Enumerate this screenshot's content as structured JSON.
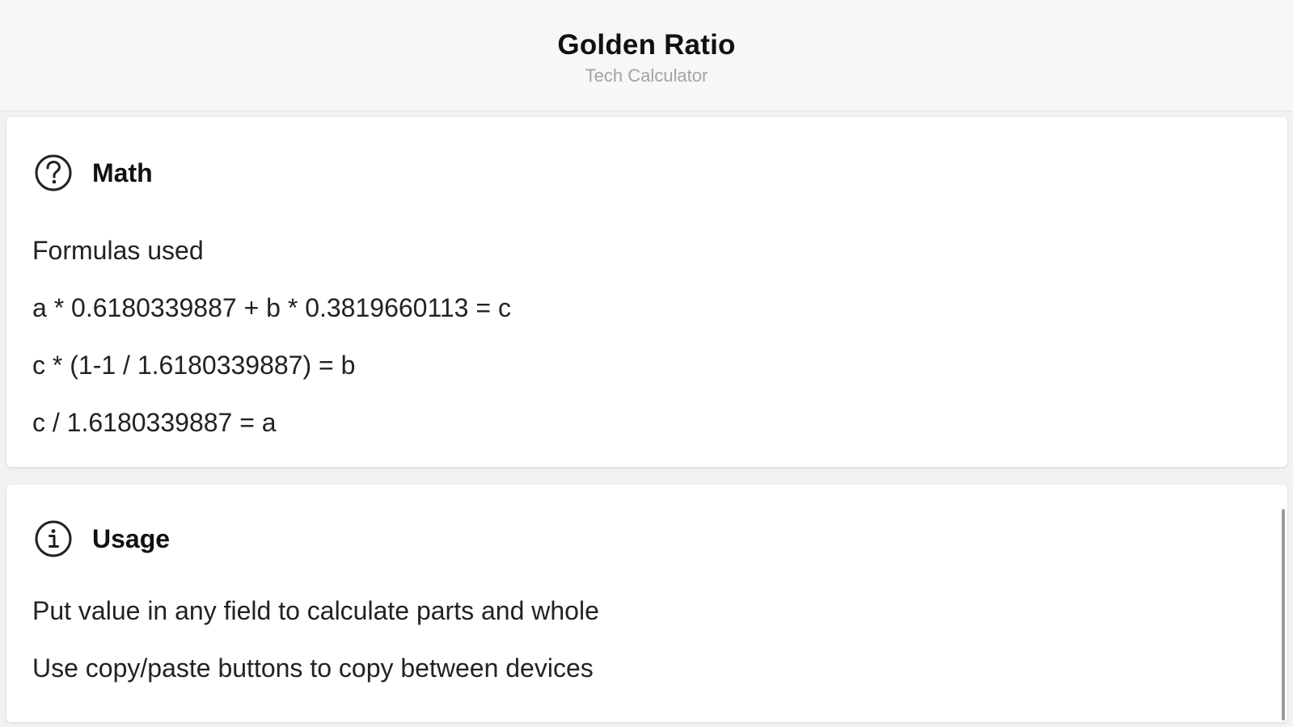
{
  "header": {
    "title": "Golden Ratio",
    "subtitle": "Tech Calculator"
  },
  "math": {
    "title": "Math",
    "icon": "question-circle-icon",
    "lines": [
      "Formulas used",
      "a * 0.6180339887 + b * 0.3819660113 = c",
      "c * (1-1 / 1.6180339887) = b",
      "c / 1.6180339887 = a"
    ]
  },
  "usage": {
    "title": "Usage",
    "icon": "info-circle-icon",
    "lines": [
      "Put value in any field to calculate parts and whole",
      "Use copy/paste buttons to copy between devices"
    ]
  }
}
